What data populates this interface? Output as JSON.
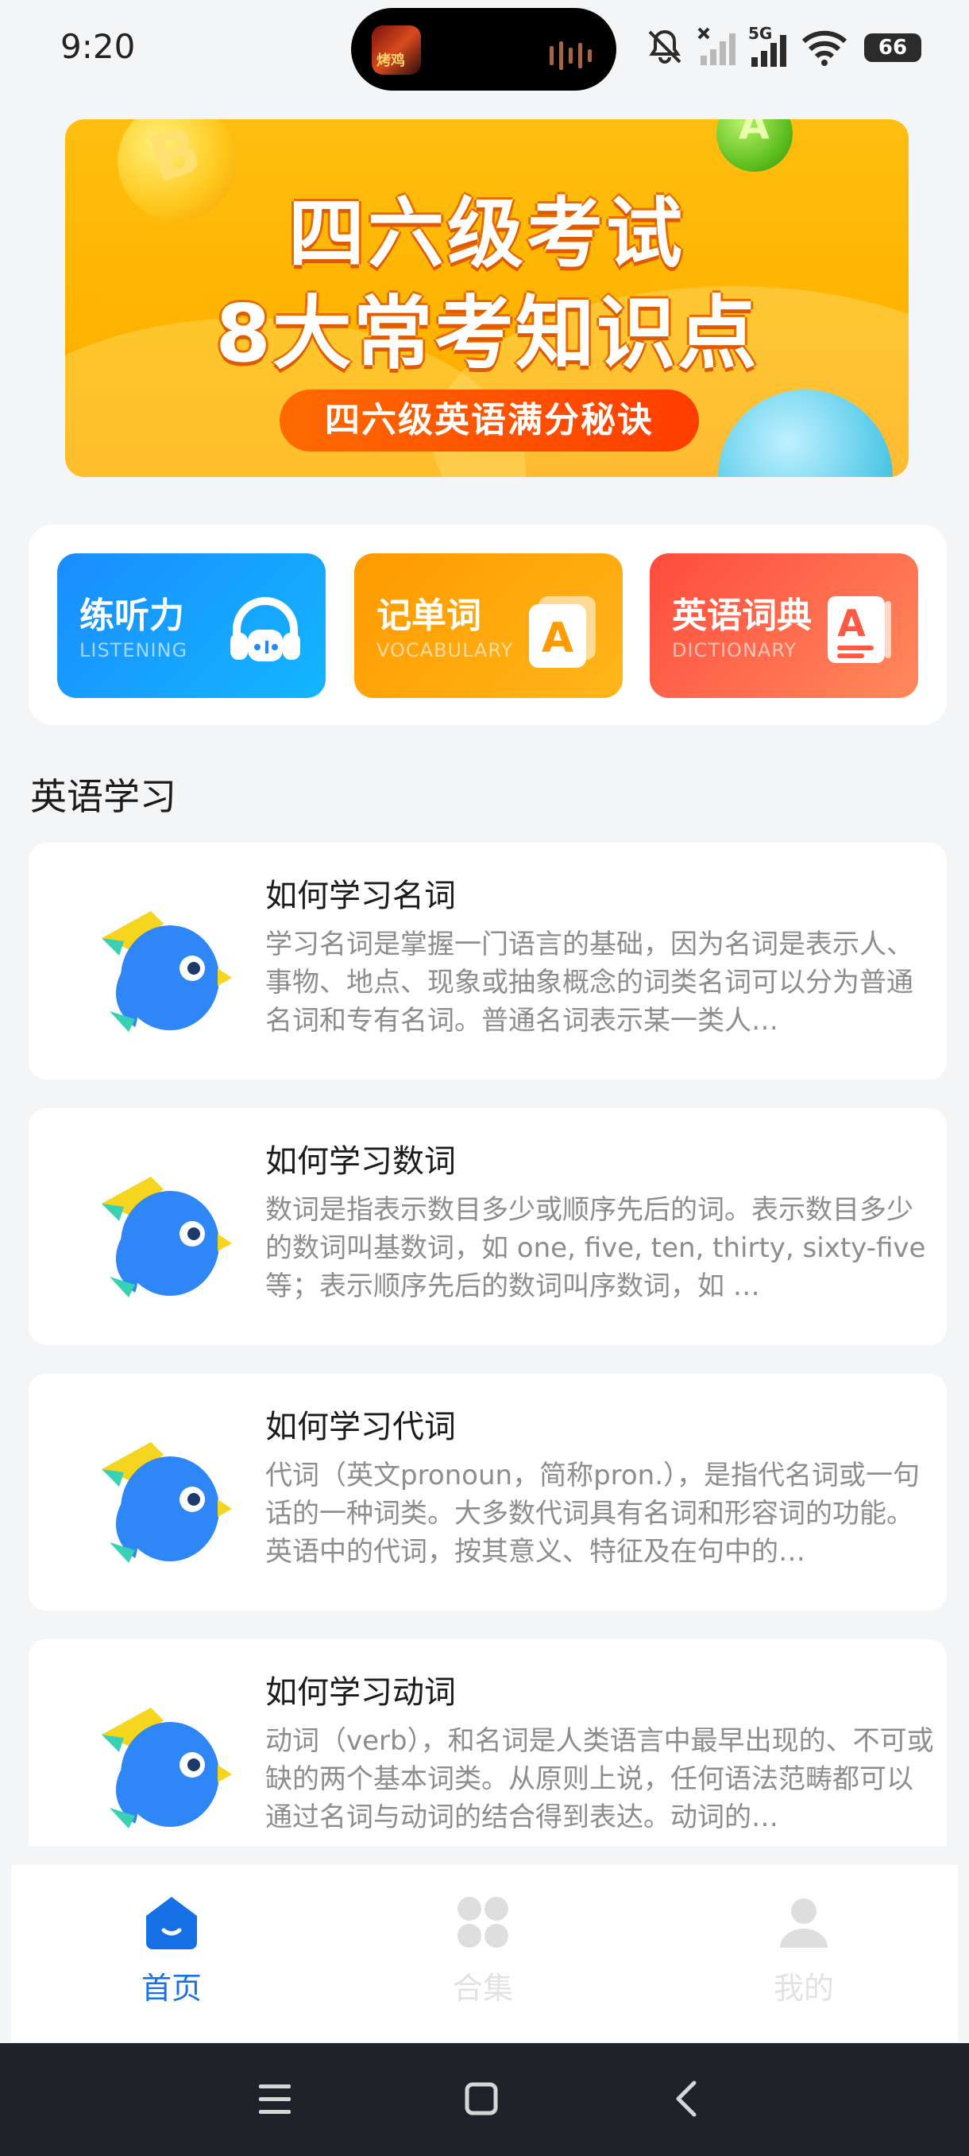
{
  "status_bar": {
    "time": "9:20",
    "island_thumb_text": "烤鸡",
    "network": "5G",
    "battery": "66"
  },
  "banner": {
    "badge_b": "B",
    "badge_a": "A",
    "title_line1": "四六级考试",
    "title_line2": "8大常考知识点",
    "pill": "四六级英语满分秘诀"
  },
  "tiles": [
    {
      "title": "练听力",
      "subtitle": "LISTENING",
      "icon": "headphones-icon"
    },
    {
      "title": "记单词",
      "subtitle": "VOCABULARY",
      "icon": "letter-card-icon"
    },
    {
      "title": "英语词典",
      "subtitle": "DICTIONARY",
      "icon": "dictionary-book-icon"
    }
  ],
  "section": {
    "title": "英语学习"
  },
  "articles": [
    {
      "title": "如何学习名词",
      "body": "学习名词是掌握一门语言的基础，因为名词是表示人、事物、地点、现象或抽象概念的词类名词可以分为普通名词和专有名词。普通名词表示某一类人…"
    },
    {
      "title": "如何学习数词",
      "body": "数词是指表示数目多少或顺序先后的词。表示数目多少的数词叫基数词，如 one, five, ten, thirty, sixty-five 等；表示顺序先后的数词叫序数词，如 …"
    },
    {
      "title": "如何学习代词",
      "body": "代词（英文pronoun，简称pron.），是指代名词或一句话的一种词类。大多数代词具有名词和形容词的功能。英语中的代词，按其意义、特征及在句中的…"
    },
    {
      "title": "如何学习动词",
      "body": "动词（verb），和名词是人类语言中最早出现的、不可或缺的两个基本词类。从原则上说，任何语法范畴都可以通过名词与动词的结合得到表达。动词的…"
    }
  ],
  "bottom_nav": [
    {
      "label": "首页",
      "icon": "home-icon",
      "active": true
    },
    {
      "label": "合集",
      "icon": "collection-grid-icon",
      "active": false
    },
    {
      "label": "我的",
      "icon": "profile-icon",
      "active": false
    }
  ],
  "colors": {
    "accent": "#1671e6",
    "banner": "#ffb300",
    "listen_tile": "#1a8cff",
    "vocab_tile": "#ff9a00",
    "dict_tile": "#ff4b3e",
    "bird": "#2f86f6"
  }
}
